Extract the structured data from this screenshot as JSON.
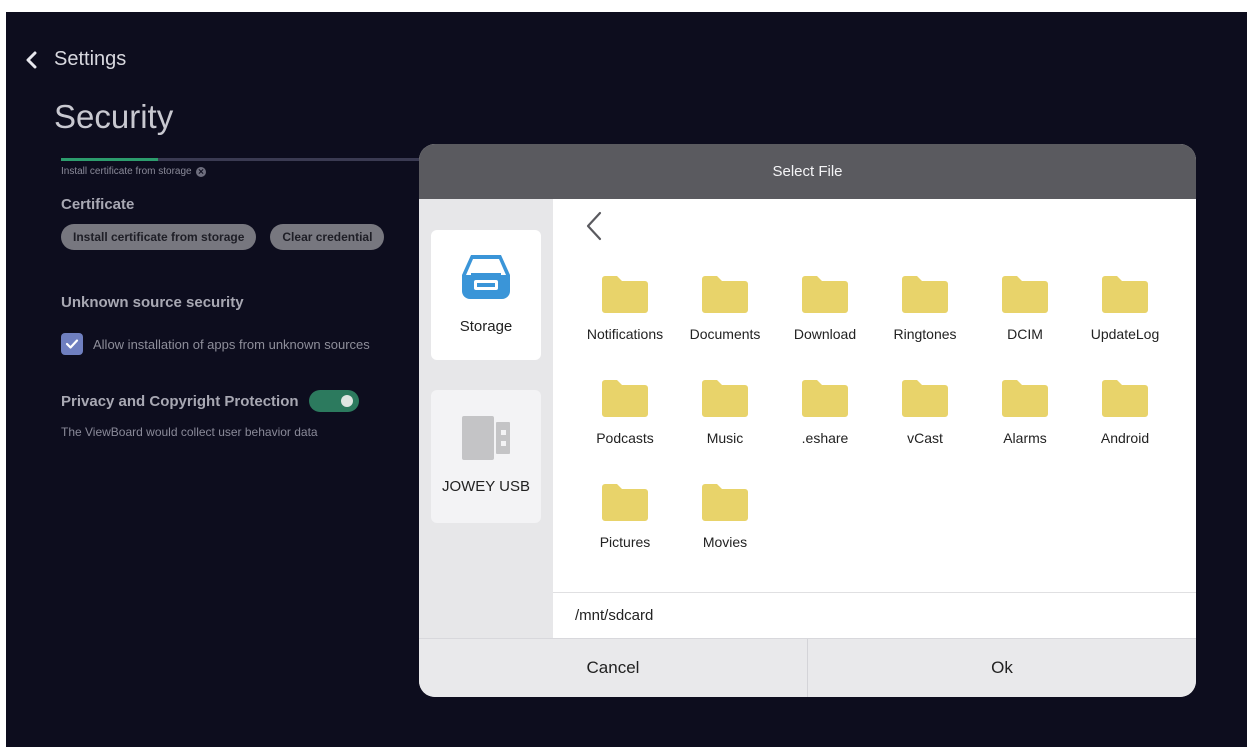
{
  "settings": {
    "back_label": "Settings",
    "page_title": "Security",
    "progress_fraction": 0.27,
    "breadcrumb": "Install certificate from storage",
    "certificate": {
      "heading": "Certificate",
      "install_button": "Install certificate from storage",
      "clear_button": "Clear credential"
    },
    "unknown_source": {
      "heading": "Unknown source security",
      "checkbox_label": "Allow installation of apps from unknown sources",
      "checked": true
    },
    "privacy": {
      "label": "Privacy and Copyright Protection",
      "enabled": true,
      "description": "The ViewBoard would collect user behavior data"
    }
  },
  "dialog": {
    "title": "Select File",
    "sources": [
      {
        "label": "Storage",
        "icon": "storage-tray-icon",
        "selected": true
      },
      {
        "label": "JOWEY USB",
        "icon": "usb-drive-icon",
        "selected": false
      }
    ],
    "folders": [
      "Notifications",
      "Documents",
      "Download",
      "Ringtones",
      "DCIM",
      "UpdateLog",
      "Podcasts",
      "Music",
      ".eshare",
      "vCast",
      "Alarms",
      "Android",
      "Pictures",
      "Movies"
    ],
    "path": "/mnt/sdcard",
    "cancel_label": "Cancel",
    "ok_label": "Ok"
  },
  "colors": {
    "background": "#0d0d1e",
    "accent_green": "#2c9c6d",
    "folder": "#e8d36a",
    "storage_icon": "#3a95d8"
  }
}
